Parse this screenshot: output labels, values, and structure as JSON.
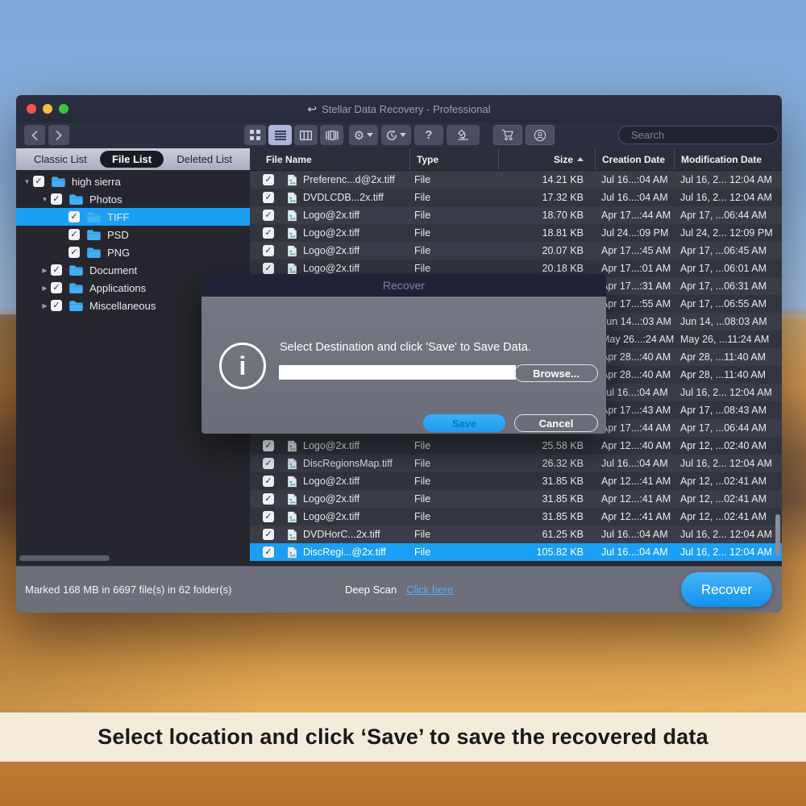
{
  "colors": {
    "accent_blue": "#1b9ff5",
    "link_blue": "#53aefc",
    "folder_blue": "#41aef5",
    "traffic_red": "#f7554c",
    "traffic_yellow": "#f6bd3f",
    "traffic_green": "#37c83c",
    "caption_bg": "#f4ebdb"
  },
  "caption": "Select location and click ‘Save’ to save the recovered data",
  "window": {
    "title": "Stellar Data Recovery - Professional",
    "toolbar": {
      "help_label": "?",
      "search_placeholder": "Search"
    },
    "sidebar": {
      "tabs": [
        {
          "label": "Classic List",
          "active": false
        },
        {
          "label": "File List",
          "active": true
        },
        {
          "label": "Deleted List",
          "active": false
        }
      ],
      "tree": [
        {
          "label": "high sierra",
          "level": 1,
          "disclosure": "open",
          "checked": true,
          "selected": false
        },
        {
          "label": "Photos",
          "level": 2,
          "disclosure": "open",
          "checked": true,
          "selected": false
        },
        {
          "label": "TIFF",
          "level": 3,
          "disclosure": "none",
          "checked": true,
          "selected": true
        },
        {
          "label": "PSD",
          "level": 3,
          "disclosure": "none",
          "checked": true,
          "selected": false
        },
        {
          "label": "PNG",
          "level": 3,
          "disclosure": "none",
          "checked": true,
          "selected": false
        },
        {
          "label": "Document",
          "level": 2,
          "disclosure": "closed",
          "checked": true,
          "selected": false
        },
        {
          "label": "Applications",
          "level": 2,
          "disclosure": "closed",
          "checked": true,
          "selected": false
        },
        {
          "label": "Miscellaneous",
          "level": 2,
          "disclosure": "closed",
          "checked": true,
          "selected": false
        }
      ]
    },
    "table": {
      "columns": {
        "name": "File Name",
        "type": "Type",
        "size": "Size",
        "creation": "Creation Date",
        "modification": "Modification Date"
      },
      "sort_column": "Size",
      "rows": [
        {
          "checked": true,
          "name": "Preferenc...d@2x.tiff",
          "type": "File",
          "size": "14.21 KB",
          "creation": "Jul 16...:04 AM",
          "modification": "Jul 16, 2... 12:04 AM",
          "selected": false
        },
        {
          "checked": true,
          "name": "DVDLCDB...2x.tiff",
          "type": "File",
          "size": "17.32 KB",
          "creation": "Jul 16...:04 AM",
          "modification": "Jul 16, 2... 12:04 AM",
          "selected": false
        },
        {
          "checked": true,
          "name": "Logo@2x.tiff",
          "type": "File",
          "size": "18.70 KB",
          "creation": "Apr 17...:44 AM",
          "modification": "Apr 17, ...06:44 AM",
          "selected": false
        },
        {
          "checked": true,
          "name": "Logo@2x.tiff",
          "type": "File",
          "size": "18.81 KB",
          "creation": "Jul 24...:09 PM",
          "modification": "Jul 24, 2... 12:09 PM",
          "selected": false
        },
        {
          "checked": true,
          "name": "Logo@2x.tiff",
          "type": "File",
          "size": "20.07 KB",
          "creation": "Apr 17...:45 AM",
          "modification": "Apr 17, ...06:45 AM",
          "selected": false
        },
        {
          "checked": true,
          "name": "Logo@2x.tiff",
          "type": "File",
          "size": "20.18 KB",
          "creation": "Apr 17...:01 AM",
          "modification": "Apr 17, ...06:01 AM",
          "selected": false
        },
        {
          "checked": true,
          "name": "",
          "type": "",
          "size": "",
          "creation": "Apr 17...:31 AM",
          "modification": "Apr 17, ...06:31 AM",
          "selected": false
        },
        {
          "checked": true,
          "name": "",
          "type": "",
          "size": "",
          "creation": "Apr 17...:55 AM",
          "modification": "Apr 17, ...06:55 AM",
          "selected": false
        },
        {
          "checked": true,
          "name": "",
          "type": "",
          "size": "",
          "creation": "Jun 14...:03 AM",
          "modification": "Jun 14, ...08:03 AM",
          "selected": false
        },
        {
          "checked": true,
          "name": "",
          "type": "",
          "size": "",
          "creation": "May 26...:24 AM",
          "modification": "May 26, ...11:24 AM",
          "selected": false
        },
        {
          "checked": true,
          "name": "",
          "type": "",
          "size": "",
          "creation": "Apr 28...:40 AM",
          "modification": "Apr 28, ...11:40 AM",
          "selected": false
        },
        {
          "checked": true,
          "name": "",
          "type": "",
          "size": "",
          "creation": "Apr 28...:40 AM",
          "modification": "Apr 28, ...11:40 AM",
          "selected": false
        },
        {
          "checked": true,
          "name": "",
          "type": "",
          "size": "",
          "creation": "Jul 16...:04 AM",
          "modification": "Jul 16, 2... 12:04 AM",
          "selected": false
        },
        {
          "checked": true,
          "name": "",
          "type": "",
          "size": "",
          "creation": "Apr 17...:43 AM",
          "modification": "Apr 17, ...08:43 AM",
          "selected": false
        },
        {
          "checked": true,
          "name": "",
          "type": "",
          "size": "",
          "creation": "Apr 17...:44 AM",
          "modification": "Apr 17, ...06:44 AM",
          "selected": false
        },
        {
          "checked": true,
          "name": "Logo@2x.tiff",
          "type": "File",
          "size": "25.58 KB",
          "creation": "Apr 12...:40 AM",
          "modification": "Apr 12, ...02:40 AM",
          "selected": false
        },
        {
          "checked": true,
          "name": "DiscRegionsMap.tiff",
          "type": "File",
          "size": "26.32 KB",
          "creation": "Jul 16...:04 AM",
          "modification": "Jul 16, 2... 12:04 AM",
          "selected": false
        },
        {
          "checked": true,
          "name": "Logo@2x.tiff",
          "type": "File",
          "size": "31.85 KB",
          "creation": "Apr 12...:41 AM",
          "modification": "Apr 12, ...02:41 AM",
          "selected": false
        },
        {
          "checked": true,
          "name": "Logo@2x.tiff",
          "type": "File",
          "size": "31.85 KB",
          "creation": "Apr 12...:41 AM",
          "modification": "Apr 12, ...02:41 AM",
          "selected": false
        },
        {
          "checked": true,
          "name": "Logo@2x.tiff",
          "type": "File",
          "size": "31.85 KB",
          "creation": "Apr 12...:41 AM",
          "modification": "Apr 12, ...02:41 AM",
          "selected": false
        },
        {
          "checked": true,
          "name": "DVDHorC...2x.tiff",
          "type": "File",
          "size": "61.25 KB",
          "creation": "Jul 16...:04 AM",
          "modification": "Jul 16, 2... 12:04 AM",
          "selected": false
        },
        {
          "checked": true,
          "name": "DiscRegi...@2x.tiff",
          "type": "File",
          "size": "105.82 KB",
          "creation": "Jul 16...:04 AM",
          "modification": "Jul 16, 2... 12:04 AM",
          "selected": true
        }
      ]
    },
    "footer": {
      "marked": "Marked 168 MB in 6697 file(s) in 62 folder(s)",
      "deep_scan_label": "Deep Scan",
      "deep_scan_link": "Click here",
      "recover_label": "Recover"
    }
  },
  "dialog": {
    "title": "Recover",
    "message": "Select Destination and click 'Save' to Save Data.",
    "input_value": "",
    "browse_label": "Browse...",
    "save_label": "Save",
    "cancel_label": "Cancel",
    "info_glyph": "i"
  }
}
